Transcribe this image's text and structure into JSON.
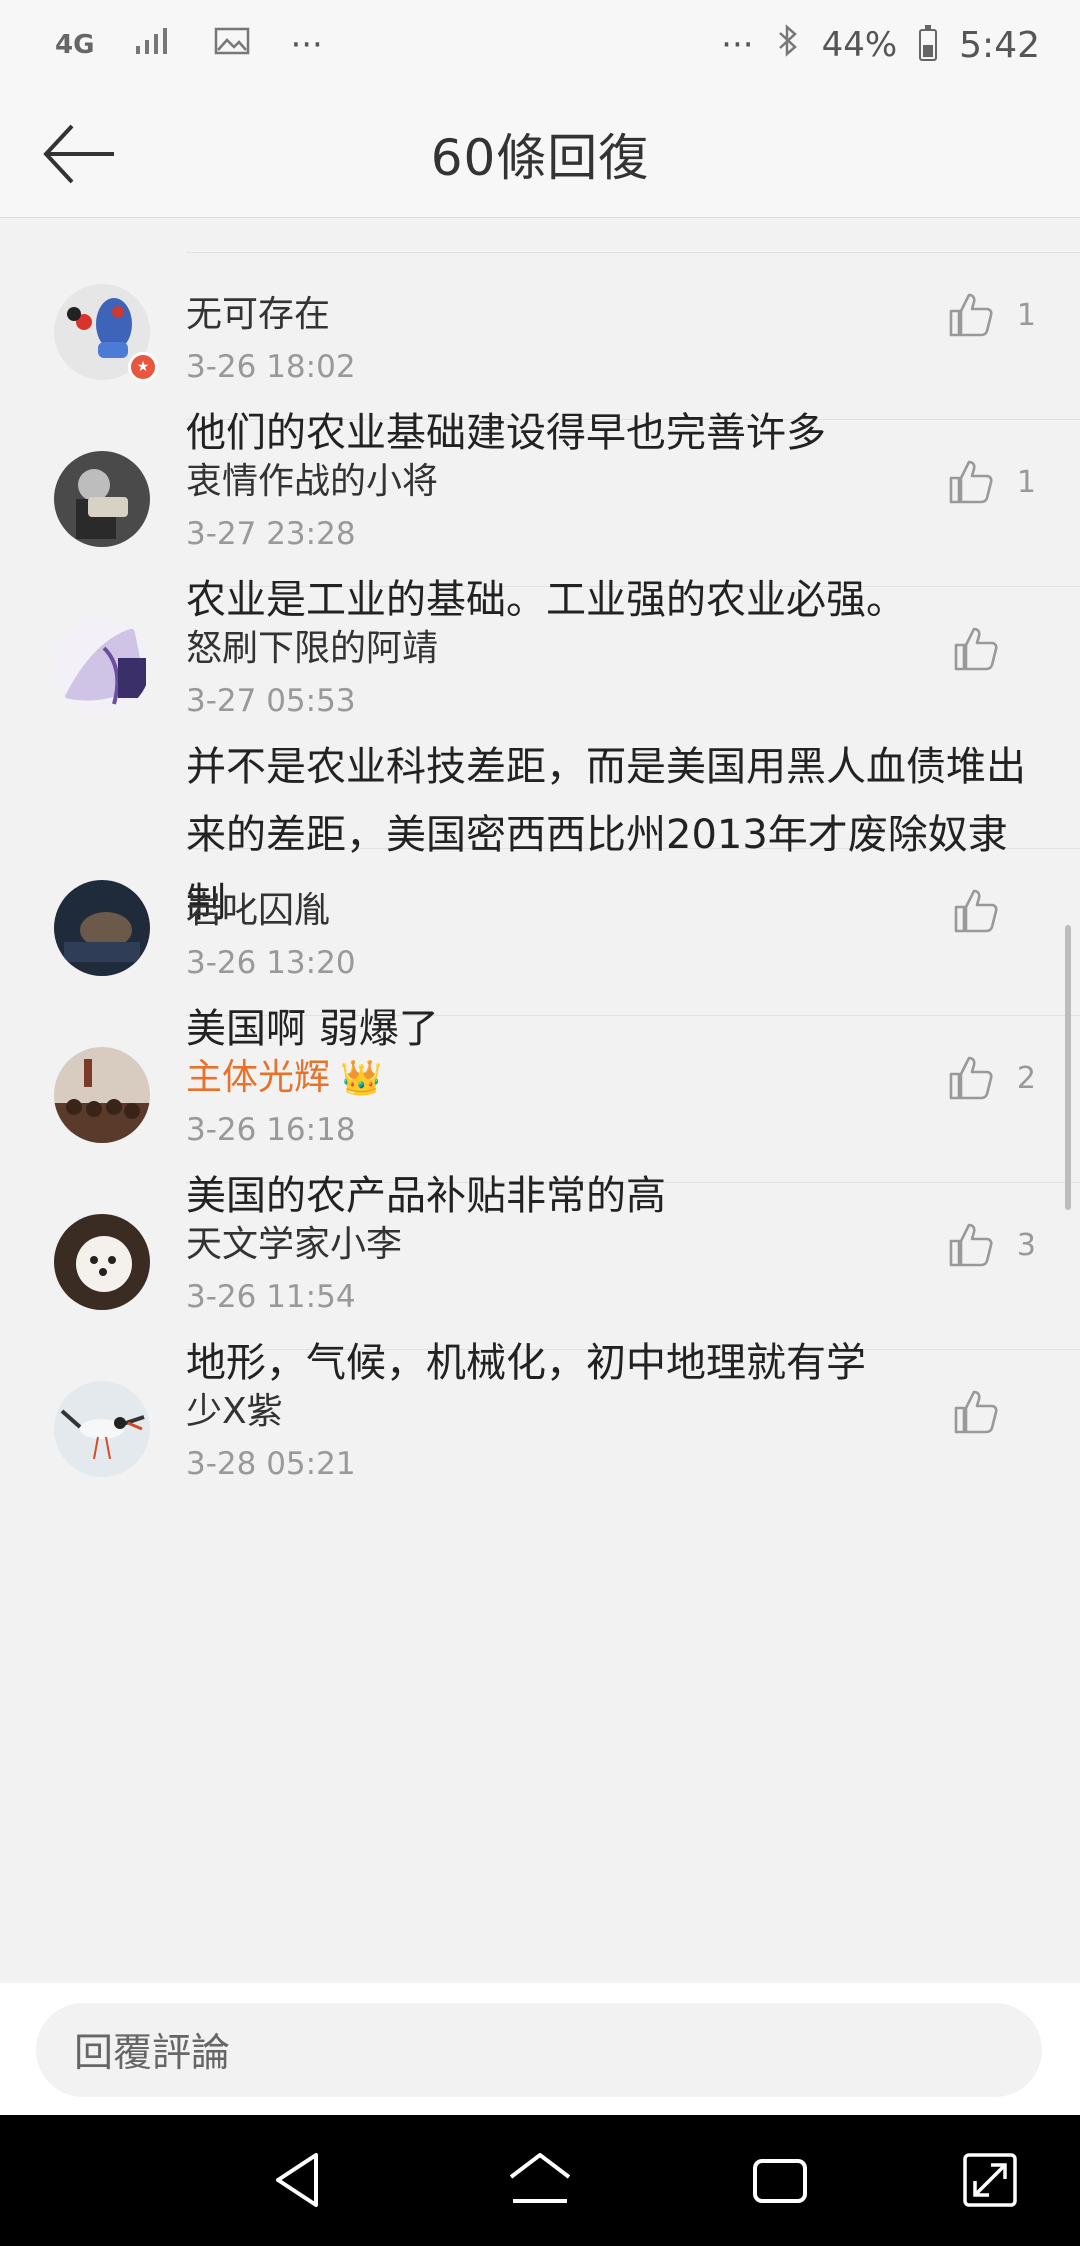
{
  "status_bar": {
    "network": "4G",
    "more_dots": "···",
    "battery_percent": "44%",
    "time": "5:42",
    "icons": [
      "signal-icon",
      "image-notification-icon",
      "bluetooth-icon",
      "battery-icon"
    ]
  },
  "header": {
    "title": "60條回復",
    "back_icon": "arrow-left-icon"
  },
  "comments": [
    {
      "username": "无可存在",
      "time": "3-26 18:02",
      "content": "他们的农业基础建设得早也完善许多",
      "likes": "1"
    },
    {
      "username": "衷情作战的小将",
      "time": "3-27 23:28",
      "content": "农业是工业的基础。工业强的农业必强。",
      "likes": "1"
    },
    {
      "username": "怒刷下限的阿靖",
      "time": "3-27 05:53",
      "content": "并不是农业科技差距，而是美国用黑人血债堆出来的差距，美国密西西比州2013年才废除奴隶制",
      "likes": ""
    },
    {
      "username": "岩叱囚胤",
      "time": "3-26 13:20",
      "content": "美国啊 弱爆了",
      "likes": ""
    },
    {
      "username": "主体光辉",
      "time": "3-26 16:18",
      "content": "美国的农产品补贴非常的高",
      "likes": "2"
    },
    {
      "username": "天文学家小李",
      "time": "3-26 11:54",
      "content": "地形，气候，机械化，初中地理就有学",
      "likes": "3"
    },
    {
      "username": "少X紫",
      "time": "3-28 05:21",
      "content": "",
      "likes": ""
    }
  ],
  "reply_bar": {
    "placeholder": "回覆評論"
  },
  "colors": {
    "vip_username": "#e8722a",
    "time_text": "#999999",
    "background": "#f2f2f2"
  }
}
